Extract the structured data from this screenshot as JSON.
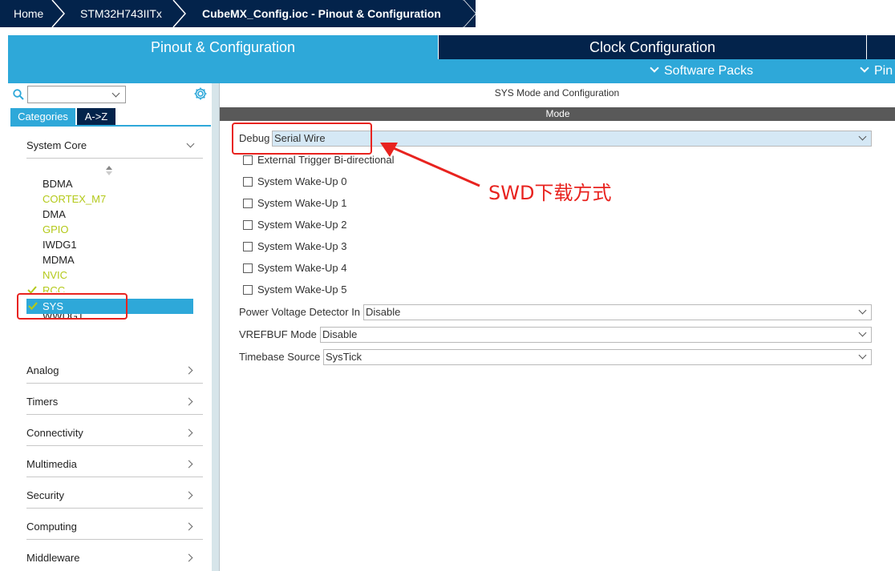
{
  "breadcrumb": {
    "home": "Home",
    "device": "STM32H743IITx",
    "file": "CubeMX_Config.ioc - Pinout & Configuration"
  },
  "tabs": {
    "pinout": "Pinout & Configuration",
    "clock": "Clock Configuration"
  },
  "subbar": {
    "software_packs": "Software Packs",
    "pinout": "Pin"
  },
  "sidebar": {
    "search": {
      "value": "",
      "icon": "search-icon"
    },
    "category_tabs": [
      "Categories",
      "A->Z"
    ],
    "system_core": "System Core",
    "peripherals": [
      "BDMA",
      "CORTEX_M7",
      "DMA",
      "GPIO",
      "IWDG1",
      "MDMA",
      "NVIC",
      "RCC",
      "SYS",
      "WWDG1"
    ],
    "sections": [
      "Analog",
      "Timers",
      "Connectivity",
      "Multimedia",
      "Security",
      "Computing",
      "Middleware"
    ]
  },
  "main": {
    "title": "SYS Mode and Configuration",
    "mode_header": "Mode",
    "debug": {
      "label": "Debug",
      "value": "Serial Wire"
    },
    "checkboxes": [
      "External Trigger Bi-directional",
      "System Wake-Up 0",
      "System Wake-Up 1",
      "System Wake-Up 2",
      "System Wake-Up 3",
      "System Wake-Up 4",
      "System Wake-Up 5"
    ],
    "pvd": {
      "label": "Power Voltage Detector In",
      "value": "Disable"
    },
    "vrefbuf": {
      "label": "VREFBUF Mode",
      "value": "Disable"
    },
    "timebase": {
      "label": "Timebase Source",
      "value": "SysTick"
    }
  },
  "annotation": {
    "text": "SWD下载方式"
  },
  "colors": {
    "navy": "#03234b",
    "accent": "#2ea8d9",
    "warning": "#b4c91a",
    "annotation": "#e8231f"
  }
}
